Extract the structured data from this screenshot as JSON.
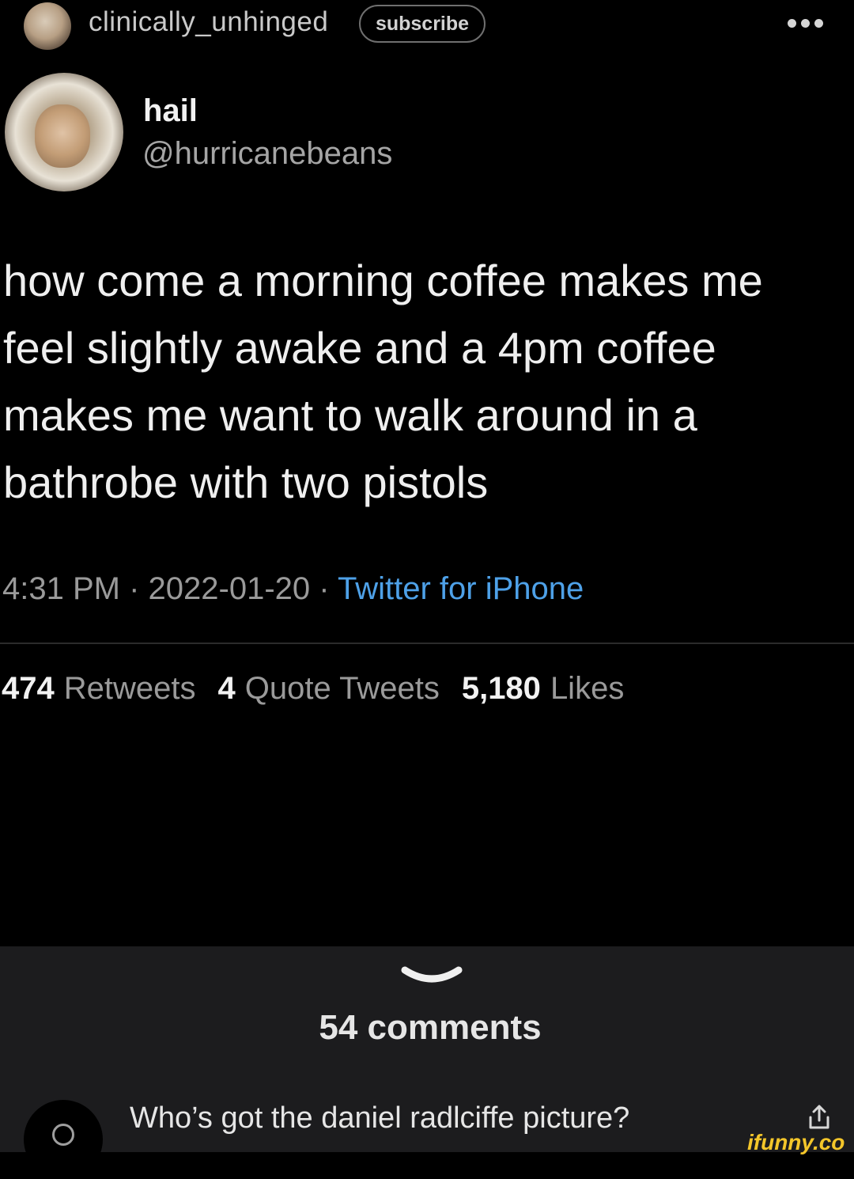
{
  "header": {
    "username": "clinically_unhinged",
    "subscribe_label": "subscribe"
  },
  "tweet": {
    "display_name": "hail",
    "handle": "@hurricanebeans",
    "text": "how come a morning coffee makes me\nfeel slightly awake and a 4pm coffee\nmakes me want to walk around in a\nbathrobe with two pistols",
    "time": "4:31 PM",
    "date": "2022-01-20",
    "source": "Twitter for iPhone",
    "separator": "·",
    "stats": [
      {
        "count": "474",
        "label": "Retweets"
      },
      {
        "count": "4",
        "label": "Quote Tweets"
      },
      {
        "count": "5,180",
        "label": "Likes"
      }
    ]
  },
  "comments": {
    "count_label": "54 comments",
    "first_comment": "Who’s got the daniel radlciffe picture?"
  },
  "watermark": "ifunny.co",
  "colors": {
    "background": "#000000",
    "link_blue": "#4ea1e8",
    "panel": "#1c1c1e",
    "watermark": "#f4c62a"
  }
}
